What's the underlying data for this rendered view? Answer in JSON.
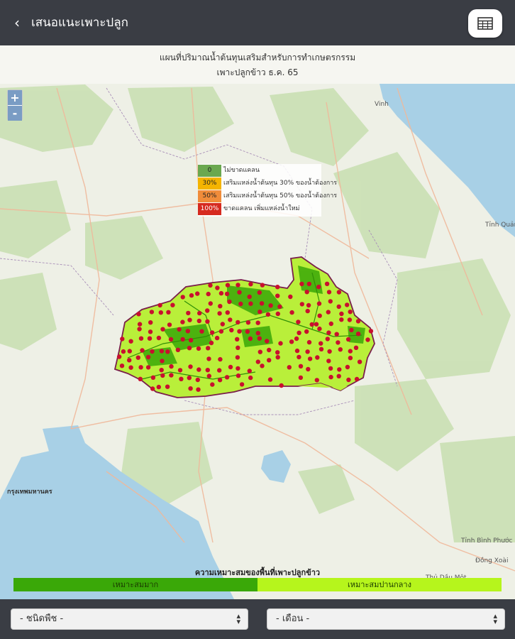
{
  "header": {
    "back_icon": "chevron-left-icon",
    "title": "เสนอแนะเพาะปลูก",
    "table_icon": "table-grid-icon"
  },
  "map": {
    "title_line1": "แผนที่ปริมาณน้ำต้นทุนเสริมสำหรับการทำเกษตรกรรม",
    "title_line2": "เพาะปลูกข้าว ธ.ค. 65",
    "zoom_in": "+",
    "zoom_out": "-",
    "legend": [
      {
        "value": "0",
        "label": "ไม่ขาดแคลน",
        "color": "#6aa84f"
      },
      {
        "value": "30%",
        "label": "เสริมแหล่งน้ำต้นทุน 30% ของน้ำต้องการ",
        "color": "#f4b400"
      },
      {
        "value": "50%",
        "label": "เสริมแหล่งน้ำต้นทุน 50% ของน้ำต้องการ",
        "color": "#f08c3a"
      },
      {
        "value": "100%",
        "label": "ขาดแคลน เพิ่มแหล่งน้ำใหม่",
        "color": "#d62a1f"
      }
    ],
    "places": {
      "vinh": "Vinh",
      "bangkok": "กรุงเทพมหานคร",
      "tinh_quang_tri": "Tỉnh Quảng Trị",
      "tinh_binh_phuoc": "Tỉnh Bình Phước",
      "dong_xoai": "Đồng Xoài",
      "thu_dau_mot": "Thủ Dầu Một"
    }
  },
  "suitability": {
    "title": "ความเหมาะสมของพื้นที่เพาะปลูกข้าว",
    "high": {
      "label": "เหมาะสมมาก",
      "color": "#3aa808"
    },
    "medium": {
      "label": "เหมาะสมปานกลาง",
      "color": "#b6f51c"
    }
  },
  "footer": {
    "crop_select": "- ชนิดพืช -",
    "month_select": "- เดือน -"
  }
}
